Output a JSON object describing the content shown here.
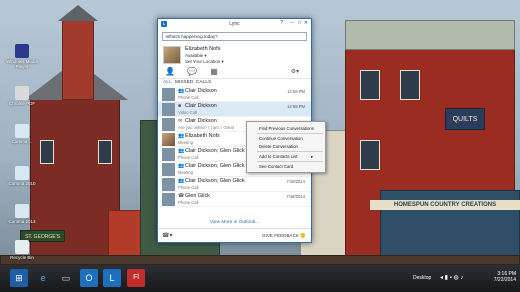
{
  "desktop": {
    "icons": [
      {
        "label": "Windows Media Player",
        "color": "#2b3a8c"
      },
      {
        "label": "Chrome PDF",
        "color": "#d9d9d9"
      },
      {
        "label": "Comma ...",
        "color": "#d6e8f2"
      },
      {
        "label": "Comma 2010",
        "color": "#d6e8f2"
      },
      {
        "label": "Comma 2013",
        "color": "#d6e8f2"
      },
      {
        "label": "Recycle Bin",
        "color": "#e7ecef"
      }
    ]
  },
  "lync": {
    "title": "Lync",
    "status_placeholder": "What's happening today?",
    "user": {
      "name": "Elizabeth Nofs",
      "availability": "Available ▾",
      "location": "Set Your Location ▾"
    },
    "filters": [
      "ALL",
      "MISSED",
      "CALLS"
    ],
    "conversations": [
      {
        "name": "Clair Dickson",
        "sub": "Phone Call",
        "time": "12:59 PM",
        "pic": "ph",
        "glyph": "👥"
      },
      {
        "name": "Clair Dickson",
        "sub": "Video Call",
        "time": "12:58 PM",
        "pic": "ph",
        "glyph": "■",
        "selected": true
      },
      {
        "name": "Clair Dickson",
        "sub": "Are you online? / I am. / Great",
        "time": "",
        "pic": "ph",
        "glyph": "✉"
      },
      {
        "name": "Elizabeth Nofs",
        "sub": "Meeting",
        "time": "",
        "pic": "pp",
        "glyph": "👥"
      },
      {
        "name": "Clair Dickson; Glen Glick",
        "sub": "Phone Call",
        "time": "",
        "pic": "ph",
        "glyph": "👥"
      },
      {
        "name": "Clair Dickson; Glen Glick",
        "sub": "Meeting",
        "time": "7/18/2014",
        "pic": "ph",
        "glyph": "👥"
      },
      {
        "name": "Clair Dickson; Glen Glick",
        "sub": "Phone Call",
        "time": "7/18/2014",
        "pic": "ph",
        "glyph": "👥"
      },
      {
        "name": "Glen Glick",
        "sub": "Phone Call",
        "time": "7/18/2014",
        "pic": "ph",
        "glyph": "☎"
      }
    ],
    "view_more": "View More in Outlook...",
    "feedback": "GIVE FEEDBACK 🙂"
  },
  "context_menu": {
    "items": [
      "Find Previous Conversations",
      "Continue Conversation",
      "Delete Conversation",
      "Add to Contacts List",
      "See Contact Card"
    ]
  },
  "taskbar": {
    "desktop_label": "Desktop",
    "time": "3:16 PM",
    "date": "7/22/2014"
  },
  "wallpaper": {
    "sign_quilts": "QUILTS",
    "sign_homespun": "HOMESPUN COUNTRY CREATIONS",
    "sign_george": "ST. GEORGE'S"
  }
}
